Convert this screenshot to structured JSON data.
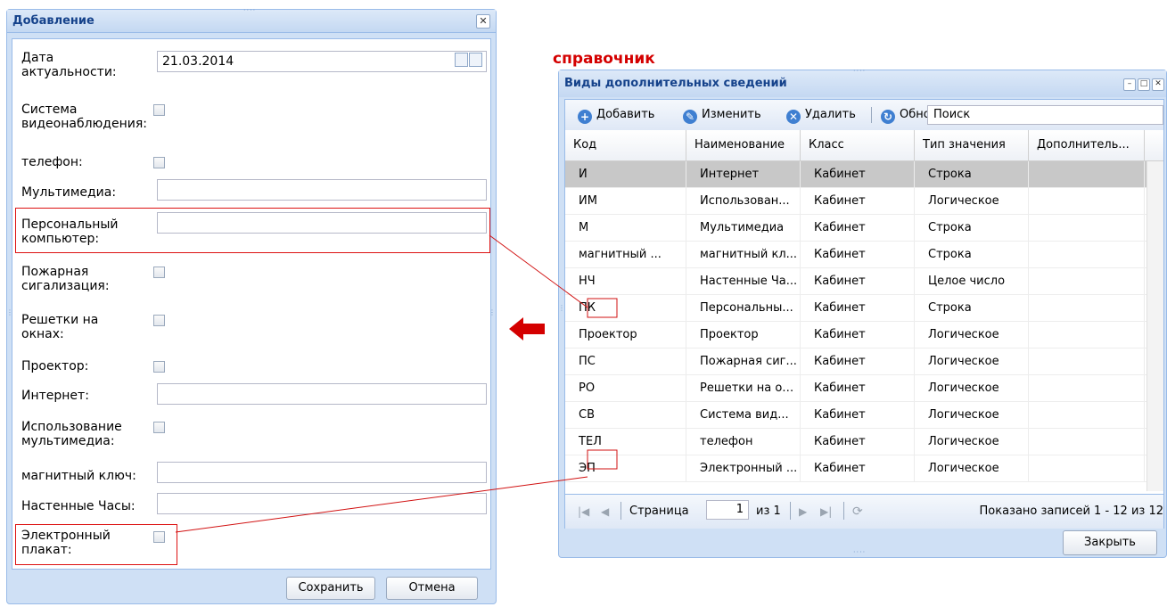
{
  "add_dialog": {
    "title": "Добавление",
    "fields": {
      "date_label": "Дата актуальности:",
      "date_value": "21.03.2014",
      "video_label": "Система видеонаблюдения:",
      "phone_label": "телефон:",
      "multimedia_label": "Мультимедиа:",
      "pc_label": "Персональный компьютер:",
      "fire_label": "Пожарная сигализация:",
      "bars_label": "Решетки на окнах:",
      "projector_label": "Проектор:",
      "internet_label": "Интернет:",
      "multimedia_use_label": "Использование мультимедиа:",
      "magnet_label": "магнитный ключ:",
      "clock_label": "Настенные Часы:",
      "poster_label": "Электронный плакат:"
    },
    "save_label": "Сохранить",
    "cancel_label": "Отмена"
  },
  "caption": "справочник",
  "ref_dialog": {
    "title": "Виды дополнительных сведений",
    "toolbar": {
      "add": "Добавить",
      "edit": "Изменить",
      "delete": "Удалить",
      "refresh": "Обновить",
      "search_placeholder": "Поиск"
    },
    "columns": [
      "Код",
      "Наименование",
      "Класс",
      "Тип значения",
      "Дополнитель..."
    ],
    "rows": [
      [
        "И",
        "Интернет",
        "Кабинет",
        "Строка",
        ""
      ],
      [
        "ИМ",
        "Использован...",
        "Кабинет",
        "Логическое",
        ""
      ],
      [
        "М",
        "Мультимедиа",
        "Кабинет",
        "Строка",
        ""
      ],
      [
        "магнитный ...",
        "магнитный кл...",
        "Кабинет",
        "Строка",
        ""
      ],
      [
        "НЧ",
        "Настенные Ча...",
        "Кабинет",
        "Целое число",
        ""
      ],
      [
        "ПК",
        "Персональны...",
        "Кабинет",
        "Строка",
        ""
      ],
      [
        "Проектор",
        "Проектор",
        "Кабинет",
        "Логическое",
        ""
      ],
      [
        "ПС",
        "Пожарная сиг...",
        "Кабинет",
        "Логическое",
        ""
      ],
      [
        "РО",
        "Решетки на ок...",
        "Кабинет",
        "Логическое",
        ""
      ],
      [
        "СВ",
        "Система вид...",
        "Кабинет",
        "Логическое",
        ""
      ],
      [
        "ТЕЛ",
        "телефон",
        "Кабинет",
        "Логическое",
        ""
      ],
      [
        "ЭП",
        "Электронный ...",
        "Кабинет",
        "Логическое",
        ""
      ]
    ],
    "paging": {
      "page_label": "Страница",
      "page_value": "1",
      "of_label": "из 1",
      "summary": "Показано записей 1 - 12 из 12"
    },
    "close_label": "Закрыть"
  },
  "colors": {
    "highlight": "#d11111",
    "arrow": "#d40000",
    "window_frame": "#cfe0f5",
    "title_text": "#15428b"
  },
  "icons": [
    "close-icon",
    "calendar-icon",
    "select-icon",
    "add-icon",
    "edit-icon",
    "delete-icon",
    "refresh-icon",
    "first-page-icon",
    "prev-page-icon",
    "next-page-icon",
    "last-page-icon",
    "reload-icon",
    "minimize-icon",
    "maximize-icon",
    "arrow-left-icon"
  ]
}
